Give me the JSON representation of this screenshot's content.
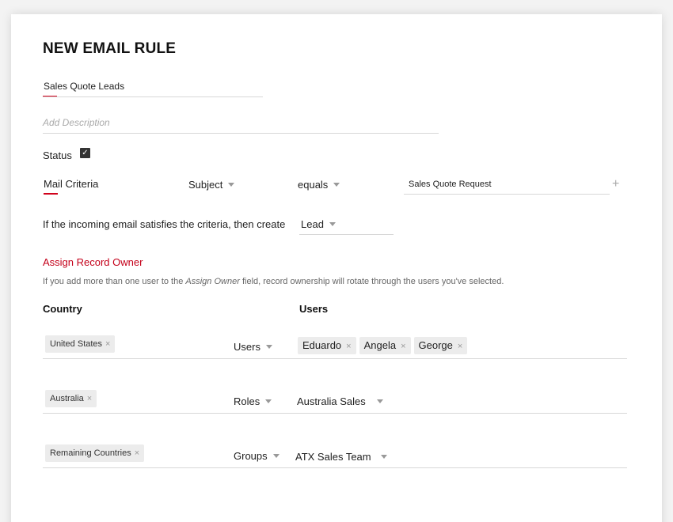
{
  "form": {
    "title": "NEW EMAIL RULE",
    "name_value": "Sales Quote Leads",
    "description_placeholder": "Add Description",
    "status_label": "Status",
    "status_checked": true
  },
  "criteria": {
    "label": "Mail Criteria",
    "field": "Subject",
    "operator": "equals",
    "value": "Sales Quote Request"
  },
  "create": {
    "sentence": "If the incoming email satisfies the criteria, then create",
    "module": "Lead"
  },
  "owner": {
    "section_title": "Assign Record Owner",
    "hint_before": "If you add more than one user to the ",
    "hint_italic": "Assign Owner",
    "hint_after": " field, record ownership will rotate through the users you've selected.",
    "col_country": "Country",
    "col_users": "Users",
    "rows": [
      {
        "country": "United States",
        "type": "Users",
        "values": [
          "Eduardo",
          "Angela",
          "George"
        ]
      },
      {
        "country": "Australia",
        "type": "Roles",
        "value": "Australia Sales"
      },
      {
        "country": "Remaining Countries",
        "type": "Groups",
        "value": "ATX Sales Team"
      }
    ]
  },
  "colors": {
    "accent": "#d0021b",
    "chip_bg": "#ececec"
  },
  "icons": {
    "remove": "×",
    "check": "✓",
    "add": "+"
  }
}
